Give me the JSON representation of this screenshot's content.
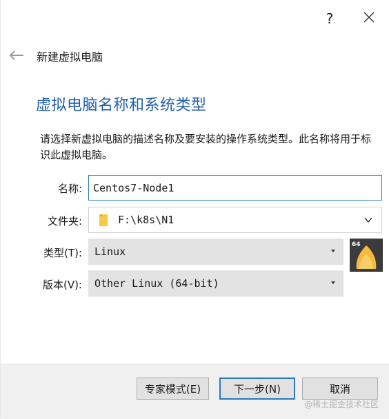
{
  "titlebar": {
    "help_label": "?",
    "help_icon": "question-mark-icon",
    "close_icon": "close-x-icon"
  },
  "header": {
    "back_icon": "arrow-left-icon",
    "title": "新建虚拟电脑"
  },
  "page": {
    "title": "虚拟电脑名称和系统类型",
    "description": "请选择新虚拟电脑的描述名称及要安装的操作系统类型。此名称将用于标识此虚拟电脑。"
  },
  "form": {
    "name_label": "名称:",
    "name_value": "Centos7-Node1",
    "folder_label": "文件夹:",
    "folder_value": "F:\\k8s\\N1",
    "folder_icon": "folder-icon",
    "type_label": "类型(T):",
    "type_value": "Linux",
    "version_label": "版本(V):",
    "version_value": "Other Linux (64-bit)",
    "os_icon": "linux-64-icon",
    "os_badge": "64"
  },
  "footer": {
    "expert_label": "专家模式(E)",
    "next_label": "下一步(N)",
    "cancel_label": "取消",
    "watermark": "@稀土掘金技术社区"
  },
  "colors": {
    "accent": "#2b78b8",
    "title_blue": "#1f5fa8",
    "combo_bg": "#e3e3e3",
    "footer_bg": "#f0f0f0"
  }
}
